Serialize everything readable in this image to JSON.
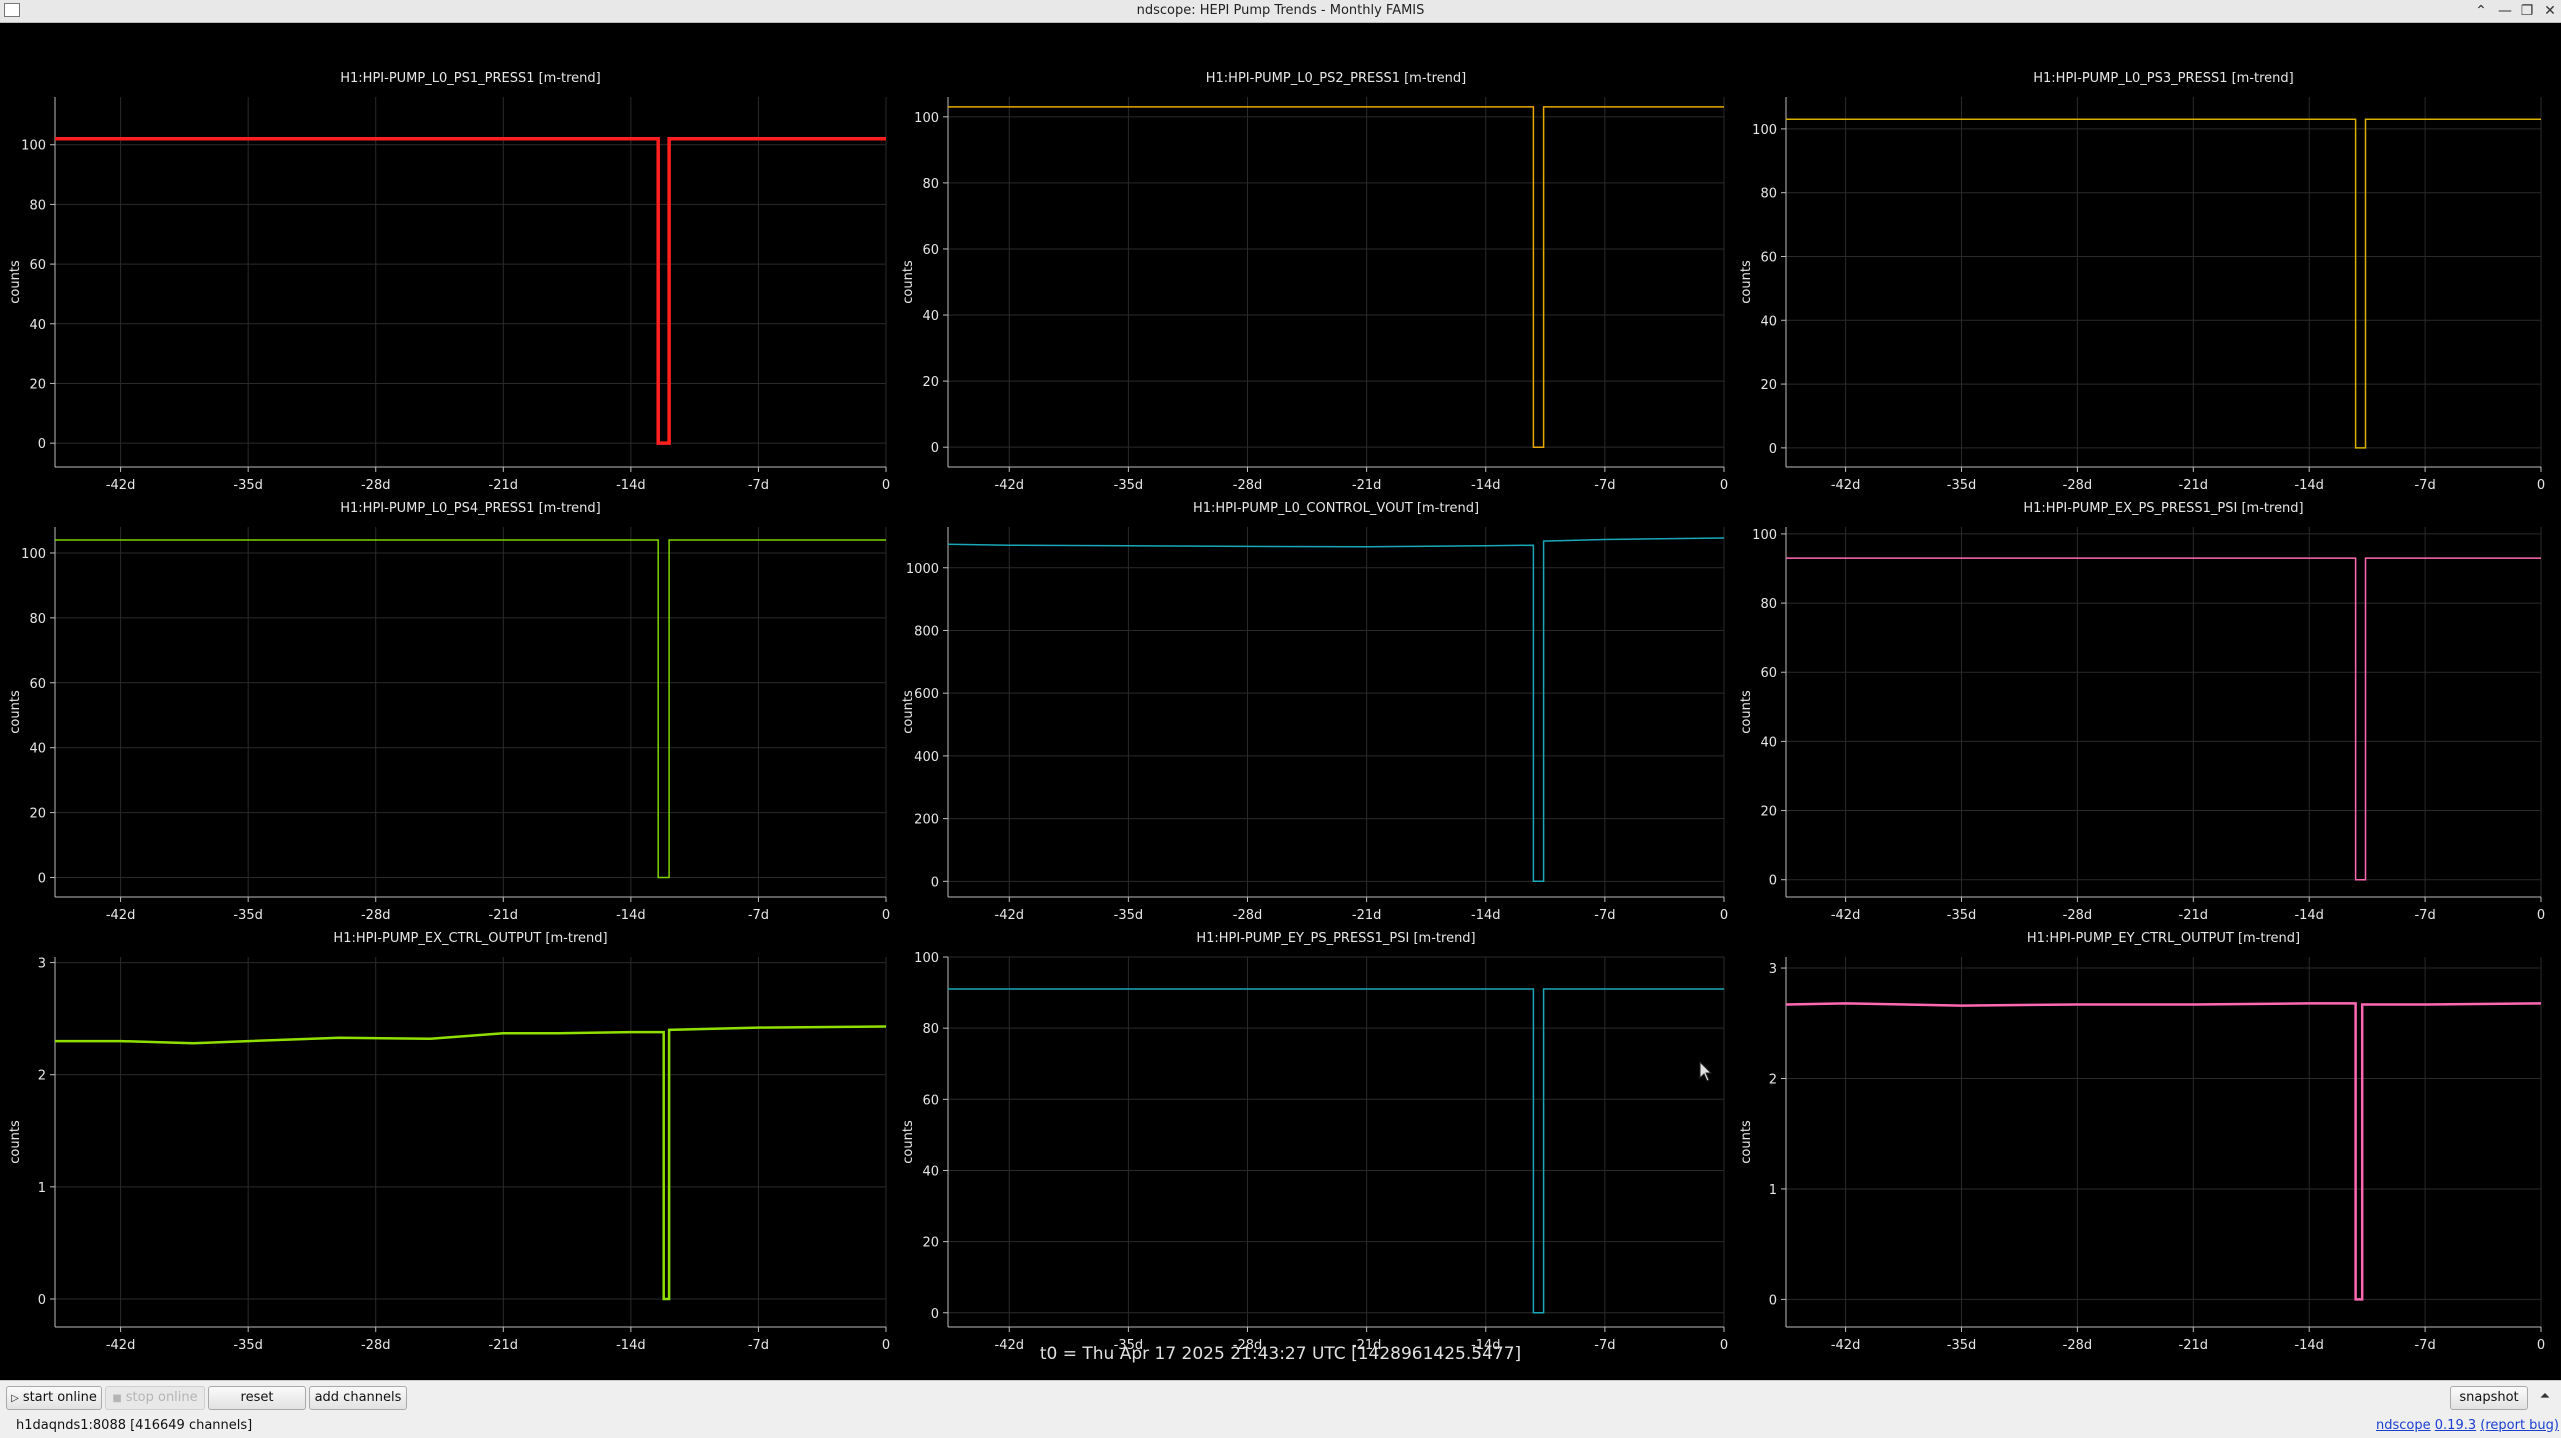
{
  "window": {
    "title": "ndscope: HEPI Pump Trends - Monthly FAMIS",
    "buttons": [
      "⌃",
      "—",
      "❐",
      "✕"
    ]
  },
  "chart_data": [
    {
      "type": "line",
      "title": "H1:HPI-PUMP_L0_PS1_PRESS1 [m-trend]",
      "ylabel": "counts",
      "yticks": [
        "0",
        "20",
        "40",
        "60",
        "80",
        "100"
      ],
      "ylim": [
        -8,
        116
      ],
      "xticks": [
        "-42d",
        "-35d",
        "-28d",
        "-21d",
        "-14d",
        "-7d",
        "0"
      ],
      "xlim": [
        -45.6,
        0
      ],
      "color": "#ff1f1f",
      "line_width": 3.5,
      "x": [
        -45.6,
        -12.5,
        -12.5,
        -11.9,
        -11.9,
        0
      ],
      "y": [
        102,
        102,
        0,
        0,
        102,
        102
      ]
    },
    {
      "type": "line",
      "title": "H1:HPI-PUMP_L0_PS2_PRESS1 [m-trend]",
      "ylabel": "counts",
      "yticks": [
        "0",
        "20",
        "40",
        "60",
        "80",
        "100"
      ],
      "ylim": [
        -6,
        106
      ],
      "xticks": [
        "-42d",
        "-35d",
        "-28d",
        "-21d",
        "-14d",
        "-7d",
        "0"
      ],
      "xlim": [
        -45.6,
        0
      ],
      "color": "#e8a800",
      "line_width": 1.5,
      "x": [
        -45.6,
        -11.2,
        -11.2,
        -10.6,
        -10.6,
        0
      ],
      "y": [
        103,
        103,
        0,
        0,
        103,
        103
      ]
    },
    {
      "type": "line",
      "title": "H1:HPI-PUMP_L0_PS3_PRESS1 [m-trend]",
      "ylabel": "counts",
      "yticks": [
        "0",
        "20",
        "40",
        "60",
        "80",
        "100"
      ],
      "ylim": [
        -6,
        110
      ],
      "xticks": [
        "-42d",
        "-35d",
        "-28d",
        "-21d",
        "-14d",
        "-7d",
        "0"
      ],
      "xlim": [
        -45.6,
        0
      ],
      "color": "#d9b000",
      "line_width": 1.5,
      "x": [
        -45.6,
        -11.2,
        -11.2,
        -10.6,
        -10.6,
        0
      ],
      "y": [
        103,
        103,
        0,
        0,
        103,
        103
      ]
    },
    {
      "type": "line",
      "title": "H1:HPI-PUMP_L0_PS4_PRESS1 [m-trend]",
      "ylabel": "counts",
      "yticks": [
        "0",
        "20",
        "40",
        "60",
        "80",
        "100"
      ],
      "ylim": [
        -6,
        108
      ],
      "xticks": [
        "-42d",
        "-35d",
        "-28d",
        "-21d",
        "-14d",
        "-7d",
        "0"
      ],
      "xlim": [
        -45.6,
        0
      ],
      "color": "#7dd400",
      "line_width": 1.5,
      "x": [
        -45.6,
        -12.5,
        -12.5,
        -11.9,
        -11.9,
        0
      ],
      "y": [
        104,
        104,
        0,
        0,
        104,
        104
      ]
    },
    {
      "type": "line",
      "title": "H1:HPI-PUMP_L0_CONTROL_VOUT [m-trend]",
      "ylabel": "counts",
      "yticks": [
        "0",
        "200",
        "400",
        "600",
        "800",
        "1000"
      ],
      "ylim": [
        -50,
        1130
      ],
      "xticks": [
        "-42d",
        "-35d",
        "-28d",
        "-21d",
        "-14d",
        "-7d",
        "0"
      ],
      "xlim": [
        -45.6,
        0
      ],
      "color": "#1aa8b8",
      "line_width": 1.5,
      "x": [
        -45.6,
        -42,
        -35,
        -28,
        -21,
        -14,
        -11.2,
        -11.2,
        -10.6,
        -10.6,
        -7,
        0
      ],
      "y": [
        1075,
        1072,
        1070,
        1068,
        1067,
        1070,
        1072,
        0,
        0,
        1085,
        1090,
        1095
      ]
    },
    {
      "type": "line",
      "title": "H1:HPI-PUMP_EX_PS_PRESS1_PSI [m-trend]",
      "ylabel": "counts",
      "yticks": [
        "0",
        "20",
        "40",
        "60",
        "80",
        "100"
      ],
      "ylim": [
        -5,
        102
      ],
      "xticks": [
        "-42d",
        "-35d",
        "-28d",
        "-21d",
        "-14d",
        "-7d",
        "0"
      ],
      "xlim": [
        -45.6,
        0
      ],
      "color": "#ff69b4",
      "line_width": 1.5,
      "x": [
        -45.6,
        -11.2,
        -11.2,
        -10.6,
        -10.6,
        0
      ],
      "y": [
        93,
        93,
        0,
        0,
        93,
        93
      ]
    },
    {
      "type": "line",
      "title": "H1:HPI-PUMP_EX_CTRL_OUTPUT [m-trend]",
      "ylabel": "counts",
      "yticks": [
        "0",
        "1",
        "2",
        "3"
      ],
      "ylim": [
        -0.25,
        3.05
      ],
      "xticks": [
        "-42d",
        "-35d",
        "-28d",
        "-21d",
        "-14d",
        "-7d",
        "0"
      ],
      "xlim": [
        -45.6,
        0
      ],
      "color": "#8fe000",
      "line_width": 2.5,
      "x": [
        -45.6,
        -42,
        -38,
        -35,
        -30,
        -25,
        -21,
        -18,
        -14,
        -12.2,
        -12.2,
        -11.9,
        -11.9,
        -7,
        0
      ],
      "y": [
        2.3,
        2.3,
        2.28,
        2.3,
        2.33,
        2.32,
        2.37,
        2.37,
        2.38,
        2.38,
        0,
        0,
        2.4,
        2.42,
        2.43
      ]
    },
    {
      "type": "line",
      "title": "H1:HPI-PUMP_EY_PS_PRESS1_PSI [m-trend]",
      "ylabel": "counts",
      "yticks": [
        "0",
        "20",
        "40",
        "60",
        "80",
        "100"
      ],
      "ylim": [
        -4,
        100
      ],
      "xticks": [
        "-42d",
        "-35d",
        "-28d",
        "-21d",
        "-14d",
        "-7d",
        "0"
      ],
      "xlim": [
        -45.6,
        0
      ],
      "color": "#1aa8b8",
      "line_width": 1.5,
      "x": [
        -45.6,
        -11.2,
        -11.2,
        -10.6,
        -10.6,
        0
      ],
      "y": [
        91,
        91,
        0,
        0,
        91,
        91
      ]
    },
    {
      "type": "line",
      "title": "H1:HPI-PUMP_EY_CTRL_OUTPUT [m-trend]",
      "ylabel": "counts",
      "yticks": [
        "0",
        "1",
        "2",
        "3"
      ],
      "ylim": [
        -0.25,
        3.1
      ],
      "xticks": [
        "-42d",
        "-35d",
        "-28d",
        "-21d",
        "-14d",
        "-7d",
        "0"
      ],
      "xlim": [
        -45.6,
        0
      ],
      "color": "#ff69b4",
      "line_width": 2.5,
      "x": [
        -45.6,
        -42,
        -35,
        -28,
        -21,
        -14,
        -11.2,
        -11.2,
        -10.8,
        -10.8,
        -7,
        0
      ],
      "y": [
        2.67,
        2.68,
        2.66,
        2.67,
        2.67,
        2.68,
        2.68,
        0,
        0,
        2.67,
        2.67,
        2.68
      ]
    }
  ],
  "plot_style": {
    "background": "#000000",
    "grid": "#2a2a2a",
    "axis": "#bdbdbd",
    "text": "#e6e6e6"
  },
  "t0_label": "t0 = Thu Apr 17 2025 21:43:27 UTC [1428961425.5477]",
  "toolbar": {
    "start_online": "start online",
    "stop_online": "stop online",
    "reset": "reset",
    "add_channels": "add channels",
    "snapshot": "snapshot",
    "collapse_icon": "chevron-up-icon"
  },
  "status": {
    "server": "h1daqnds1:8088  [416649 channels]",
    "app_name": "ndscope",
    "version": "0.19.3",
    "report": "(report bug)"
  }
}
